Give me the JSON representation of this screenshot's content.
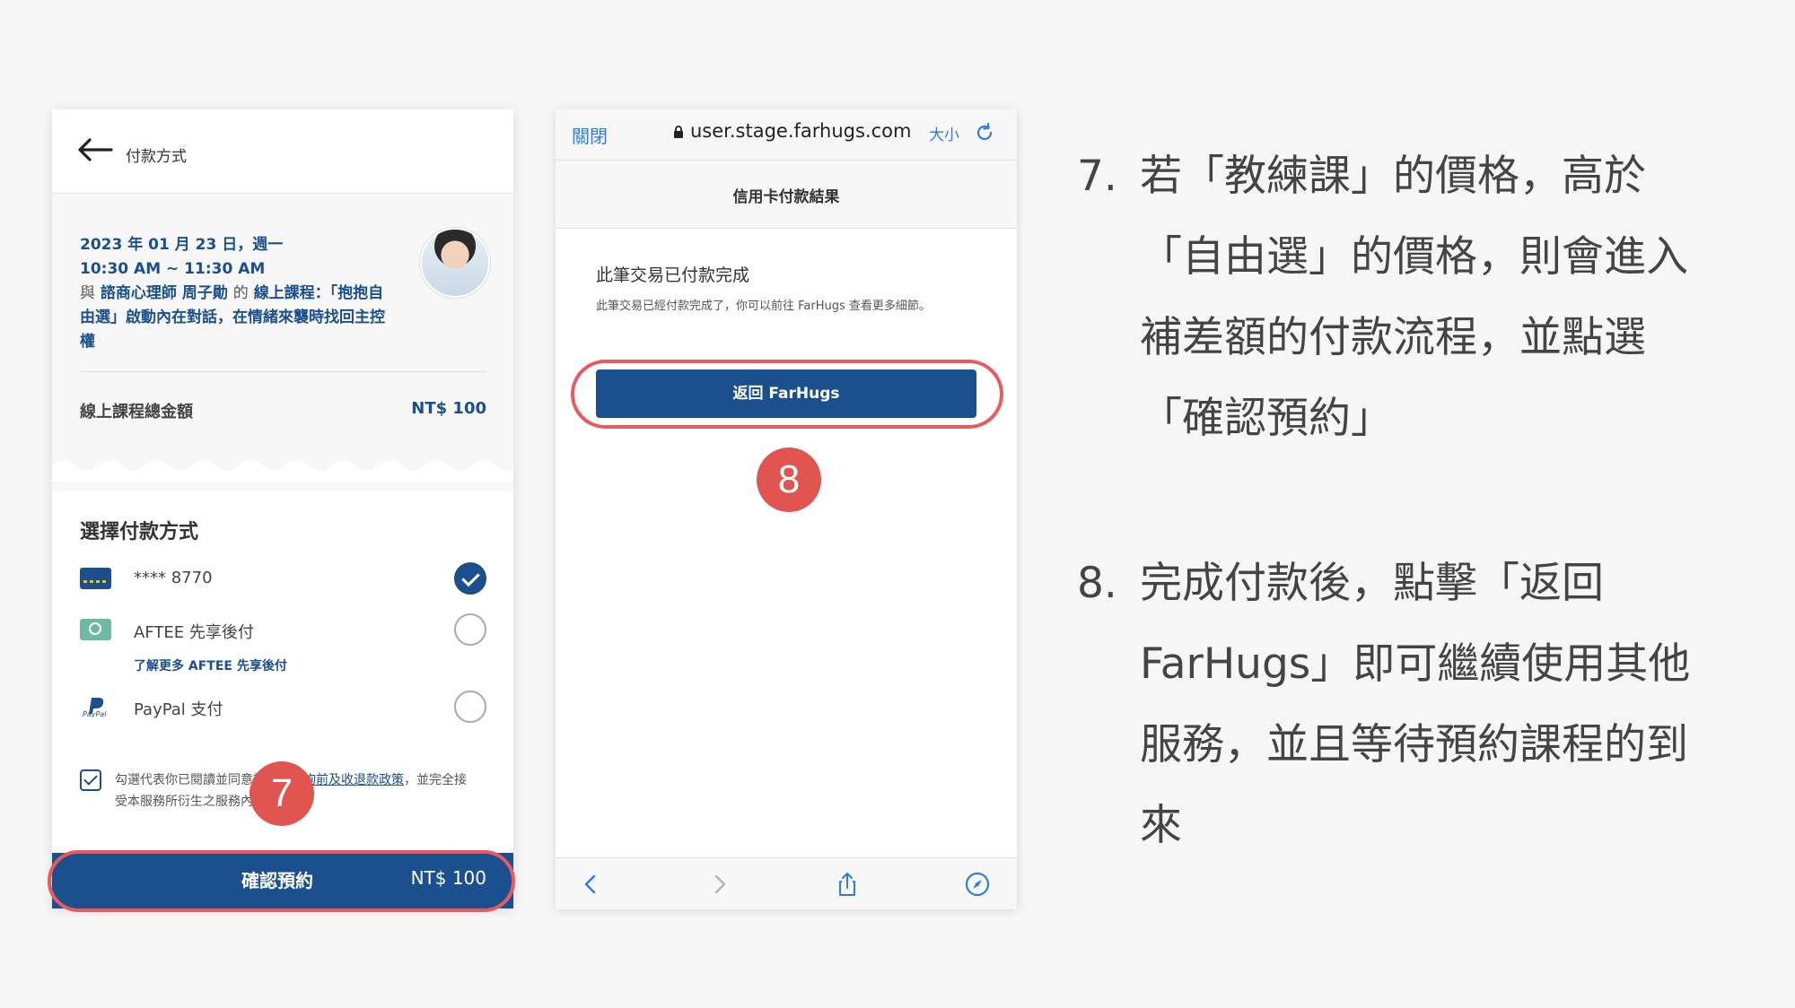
{
  "payment_screen": {
    "header_title": "付款方式",
    "course": {
      "date": "2023 年 01 月 23 日，週一",
      "time": "10:30 AM ~ 11:30 AM",
      "with": "與",
      "counselor": "諮商心理師 周子勛",
      "of": "的",
      "course_name": "線上課程：「抱抱自由選」啟動內在對話，在情緒來襲時找回主控權"
    },
    "total_label": "線上課程總金額",
    "total_value": "NT$ 100",
    "section_title": "選擇付款方式",
    "methods": [
      {
        "label": "**** 8770",
        "selected": true,
        "icon": "credit-card-icon"
      },
      {
        "label": "AFTEE 先享後付",
        "selected": false,
        "icon": "aftee-icon"
      },
      {
        "label": "PayPal 支付",
        "selected": false,
        "icon": "paypal-icon"
      }
    ],
    "aftee_link": "了解更多 AFTEE 先享後付",
    "agree_prefix": "勾選代表你已閱讀並同意",
    "agree_link": "課程與諮詢前及收退款政策",
    "agree_suffix": "，並完全接受本服務所衍生之服務內容。",
    "confirm_label": "確認預約",
    "confirm_price": "NT$ 100",
    "step_badge": "7"
  },
  "result_screen": {
    "close_label": "關閉",
    "url": "user.stage.farhugs.com",
    "text_size_label": "大小",
    "page_title": "信用卡付款結果",
    "done_title": "此筆交易已付款完成",
    "done_desc": "此筆交易已經付款完成了，你可以前往 FarHugs 查看更多細節。",
    "return_button": "返回 FarHugs",
    "step_badge": "8"
  },
  "instructions": [
    {
      "num": "7.",
      "text": "若「教練課」的價格，高於「自由選」的價格，則會進入補差額的付款流程，並點選「確認預約」"
    },
    {
      "num": "8.",
      "text": "完成付款後，點擊「返回 FarHugs」即可繼續使用其他服務，並且等待預約課程的到來"
    }
  ],
  "colors": {
    "brand_blue": "#1c4f8d",
    "highlight_red": "#e85a5f",
    "link_blue": "#2d7ee0"
  }
}
